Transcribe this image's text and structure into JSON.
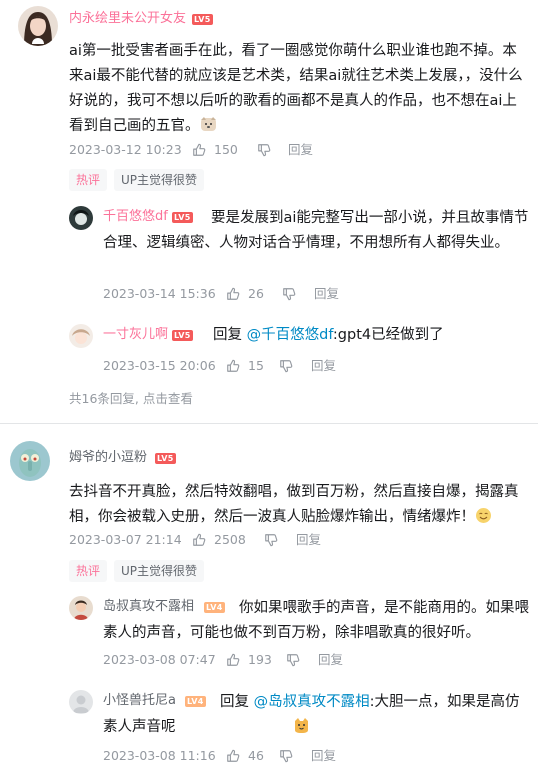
{
  "comments": [
    {
      "user": "内永绘里未公开女友",
      "level": "LV5",
      "content": "ai第一批受害者画手在此，看了一圈感觉你萌什么职业谁也跑不掉。本来ai最不能代替的就应该是艺术类，结果ai就往艺术类上发展，，没什么好说的，我可不想以后听的歌看的画都不是真人的作品，也不想在ai上看到自己画的五官。",
      "date": "2023-03-12 10:23",
      "likes": "150",
      "reply_label": "回复",
      "tags": [
        "热评",
        "UP主觉得很赞"
      ],
      "replies": [
        {
          "user": "千百悠悠df",
          "level": "LV5",
          "content": "要是发展到ai能完整写出一部小说，并且故事情节合理、逻辑缜密、人物对话合乎情理，不用想所有人都得失业。",
          "date": "2023-03-14 15:36",
          "likes": "26",
          "reply_label": "回复"
        },
        {
          "user": "一寸灰儿啊",
          "level": "LV5",
          "reply_prefix": "回复",
          "mention": "@千百悠悠df",
          "content": ":gpt4已经做到了",
          "date": "2023-03-15 20:06",
          "likes": "15",
          "reply_label": "回复"
        }
      ],
      "more_replies": "共16条回复,",
      "more_click": "点击查看"
    },
    {
      "user": "姆爷的小逗粉",
      "level": "LV5",
      "content": "去抖音不开真脸，然后特效翻唱，做到百万粉，然后直接自爆，揭露真相，你会被载入史册，然后一波真人贴脸爆炸输出，情绪爆炸！",
      "date": "2023-03-07 21:14",
      "likes": "2508",
      "reply_label": "回复",
      "tags": [
        "热评",
        "UP主觉得很赞"
      ],
      "replies": [
        {
          "user": "岛叔真攻不露相",
          "level": "LV4",
          "content": "你如果喂歌手的声音，是不能商用的。如果喂素人的声音，可能也做不到百万粉，除非唱歌真的很好听。",
          "date": "2023-03-08 07:47",
          "likes": "193",
          "reply_label": "回复"
        },
        {
          "user": "小怪兽托尼a",
          "level": "LV4",
          "reply_prefix": "回复",
          "mention": "@岛叔真攻不露相",
          "content": ":大胆一点，如果是高仿素人声音呢",
          "date": "2023-03-08 11:16",
          "likes": "46",
          "reply_label": "回复"
        }
      ]
    }
  ],
  "colors": {
    "vip_name": "#fb7299",
    "mention": "#008ac5",
    "meta": "#9499a0",
    "lv5": "#f45a5a",
    "lv4": "#ffb37c"
  },
  "icons": {
    "like": "thumb-up-icon",
    "dislike": "thumb-down-icon"
  }
}
